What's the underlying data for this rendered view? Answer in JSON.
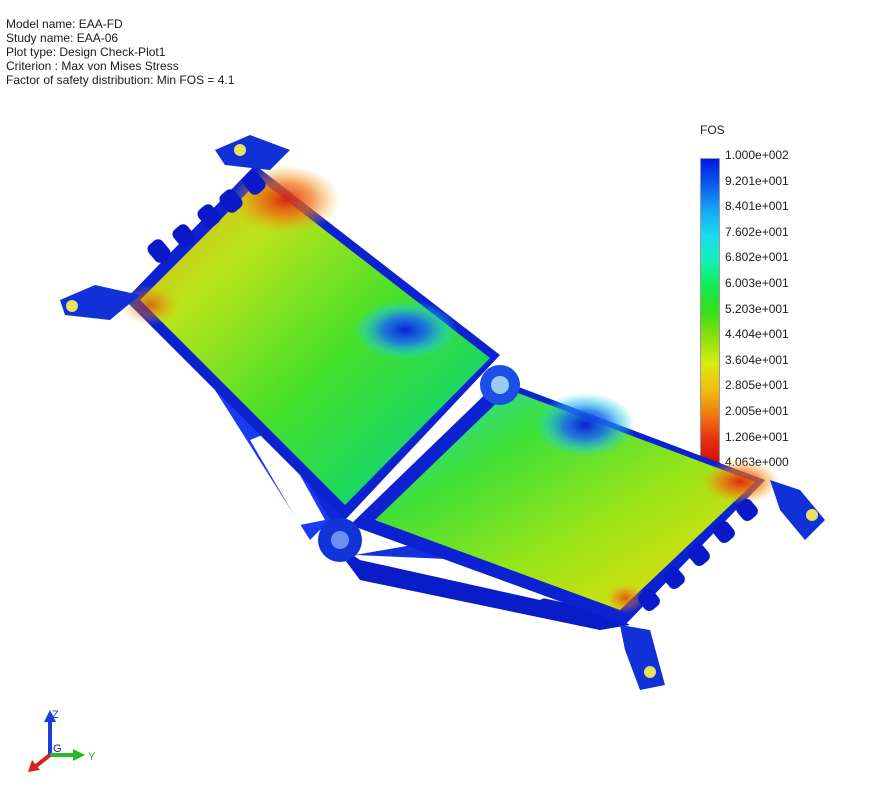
{
  "info": {
    "model_name": "Model name: EAA-FD",
    "study_name": "Study name: EAA-06",
    "plot_type": "Plot type: Design Check-Plot1",
    "criterion": "Criterion : Max von Mises Stress",
    "fos": "Factor of safety distribution: Min FOS = 4.1"
  },
  "legend": {
    "title": "FOS",
    "ticks": [
      "1.000e+002",
      "9.201e+001",
      "8.401e+001",
      "7.602e+001",
      "6.802e+001",
      "6.003e+001",
      "5.203e+001",
      "4.404e+001",
      "3.604e+001",
      "2.805e+001",
      "2.005e+001",
      "1.206e+001",
      "4.063e+000"
    ],
    "gradient_colors": [
      "#0018e0",
      "#0a5cf0",
      "#14a6f6",
      "#18dcf0",
      "#14f0b4",
      "#10ec50",
      "#36e014",
      "#8ce010",
      "#d8ec10",
      "#f0c010",
      "#f07a12",
      "#e83010",
      "#d00808"
    ]
  },
  "triad": {
    "z": "Z",
    "y": "Y",
    "g": "G"
  }
}
